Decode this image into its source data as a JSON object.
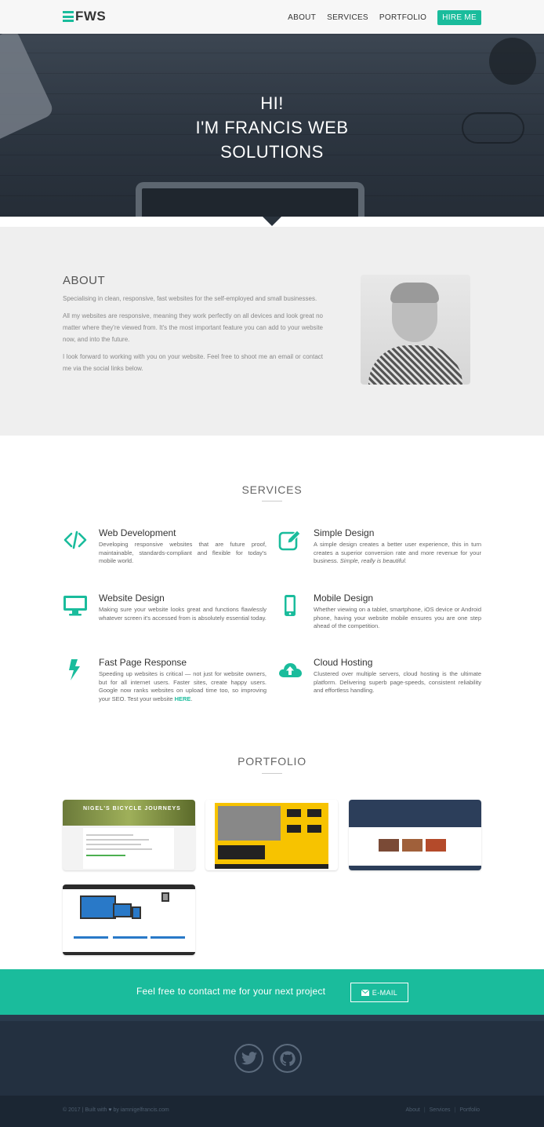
{
  "nav": {
    "logo": "FWS",
    "links": [
      "ABOUT",
      "SERVICES",
      "PORTFOLIO"
    ],
    "hire": "HIRE ME"
  },
  "hero": {
    "line1": "HI!",
    "line2": "I'M FRANCIS WEB",
    "line3": "SOLUTIONS"
  },
  "about": {
    "title": "ABOUT",
    "paragraphs": [
      "Specialising in clean, responsive, fast websites for the self-employed and small businesses.",
      "All my websites are responsive, meaning they work perfectly on all devices and look great no matter where they're viewed from. It's the most important feature you can add to your website now, and into the future.",
      "I look forward to working with you on your website. Feel free to shoot me an email or contact me via the social links below."
    ]
  },
  "services": {
    "title": "SERVICES",
    "items": [
      {
        "icon": "code-icon",
        "name": "Web Development",
        "desc": "Developing responsive websites that are future proof, maintainable, standards-compliant and flexible for today's mobile world."
      },
      {
        "icon": "edit-icon",
        "name": "Simple Design",
        "desc": "A simple design creates a better user experience, this in turn creates a superior conversion rate and more revenue for your business.",
        "desc_em": "Simple, really is beautiful."
      },
      {
        "icon": "monitor-icon",
        "name": "Website Design",
        "desc": "Making sure your website looks great and functions flawlessly whatever screen it's accessed from is absolutely essential today."
      },
      {
        "icon": "mobile-icon",
        "name": "Mobile Design",
        "desc": "Whether viewing on a tablet, smartphone, iOS device or Android phone, having your website mobile ensures you are one step ahead of the competition."
      },
      {
        "icon": "bolt-icon",
        "name": "Fast Page Response",
        "desc": "Speeding up websites is critical — not just for website owners, but for all internet users. Faster sites, create happy users. Google now ranks websites on upload time too, so improving your SEO. Test your website",
        "link": "HERE"
      },
      {
        "icon": "cloud-upload-icon",
        "name": "Cloud Hosting",
        "desc": "Clustered over multiple servers, cloud hosting is the ultimate platform. Delivering superb page-speeds, consistent reliability and effortless handling."
      }
    ]
  },
  "portfolio": {
    "title": "PORTFOLIO",
    "thumb1_banner": "NIGEL'S BICYCLE JOURNEYS"
  },
  "cta": {
    "text": "Feel free to contact me for your next project",
    "button": "E-MAIL"
  },
  "footer": {
    "copyright": "© 2017  |  Built with",
    "by": "by iamnigelfrancis.com",
    "links": [
      "About",
      "Services",
      "Portfolio"
    ]
  },
  "colors": {
    "accent": "#1abc9c",
    "footer": "#233040"
  }
}
